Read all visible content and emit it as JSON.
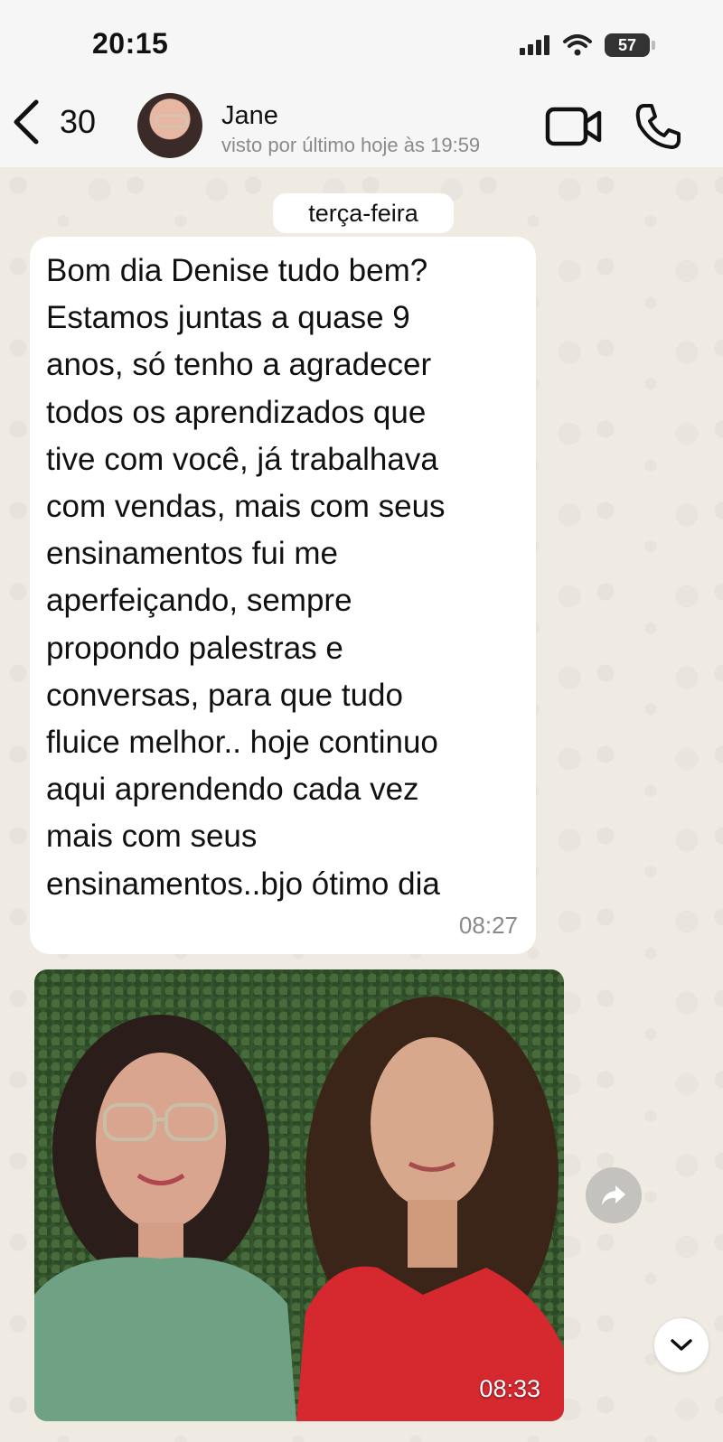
{
  "status_bar": {
    "time": "20:15",
    "battery": "57"
  },
  "header": {
    "back_count": "30",
    "contact_name": "Jane",
    "last_seen": "visto por último hoje às 19:59"
  },
  "date_separator": "terça-feira",
  "messages": [
    {
      "type": "text",
      "text": "Bom dia Denise tudo bem?\nEstamos juntas a quase  9\nanos, só tenho a agradecer\ntodos os aprendizados que\ntive com você, já trabalhava\ncom vendas, mais com seus\nensinamentos fui me\naperfeiçando, sempre\npropondo palestras e\nconversas, para que tudo\nfluice melhor.. hoje continuo\naqui aprendendo cada vez\nmais com seus\nensinamentos..bjo ótimo dia",
      "time": "08:27"
    },
    {
      "type": "image",
      "time": "08:33"
    }
  ],
  "icons": {
    "back": "chevron-left-icon",
    "video": "video-camera-icon",
    "call": "phone-icon",
    "forward": "forward-icon",
    "scroll_down": "chevron-down-icon",
    "signal": "signal-icon",
    "wifi": "wifi-icon"
  },
  "colors": {
    "wallpaper": "#efeae2",
    "bubble": "#ffffff",
    "header": "#f6f6f6"
  }
}
